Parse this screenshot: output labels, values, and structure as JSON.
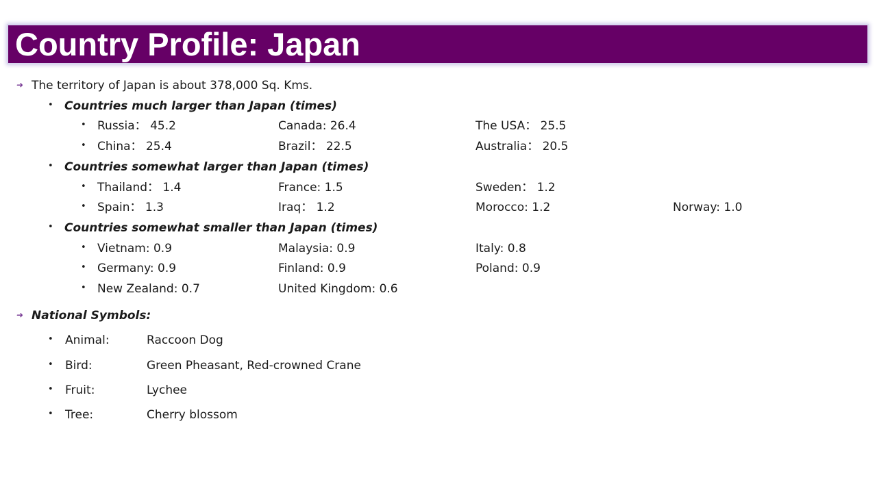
{
  "title": "Country Profile: Japan",
  "territory_line": "The territory of Japan is about 378,000 Sq. Kms.",
  "groups": [
    {
      "heading": "Countries much larger than Japan (times)",
      "rows": [
        [
          "Russia： 45.2",
          "Canada: 26.4",
          "The USA： 25.5",
          ""
        ],
        [
          "China： 25.4",
          "Brazil： 22.5",
          "Australia： 20.5",
          ""
        ]
      ]
    },
    {
      "heading": "Countries somewhat larger than Japan (times)",
      "rows": [
        [
          "Thailand： 1.4",
          "France: 1.5",
          "Sweden： 1.2",
          ""
        ],
        [
          "Spain： 1.3",
          "Iraq： 1.2",
          "Morocco: 1.2",
          "Norway: 1.0"
        ]
      ]
    },
    {
      "heading": "Countries somewhat smaller than Japan (times)",
      "rows": [
        [
          "Vietnam: 0.9",
          "Malaysia: 0.9",
          "Italy: 0.8",
          ""
        ],
        [
          "Germany: 0.9",
          "Finland: 0.9",
          "Poland: 0.9",
          ""
        ],
        [
          "New Zealand: 0.7",
          "United Kingdom: 0.6",
          "",
          ""
        ]
      ]
    }
  ],
  "symbols_heading": "National Symbols:",
  "symbols": [
    {
      "label": "Animal:",
      "value": "Raccoon Dog"
    },
    {
      "label": "Bird:",
      "value": "Green Pheasant, Red-crowned Crane"
    },
    {
      "label": "Fruit:",
      "value": "Lychee"
    },
    {
      "label": "Tree:",
      "value": "Cherry blossom"
    }
  ],
  "icons": {
    "arrow": "arrow-bullet-icon",
    "bullet": "bullet-dot-icon"
  },
  "colors": {
    "title_bg": "#660066",
    "title_text": "#ffffff",
    "arrow": "#7a3d96"
  }
}
